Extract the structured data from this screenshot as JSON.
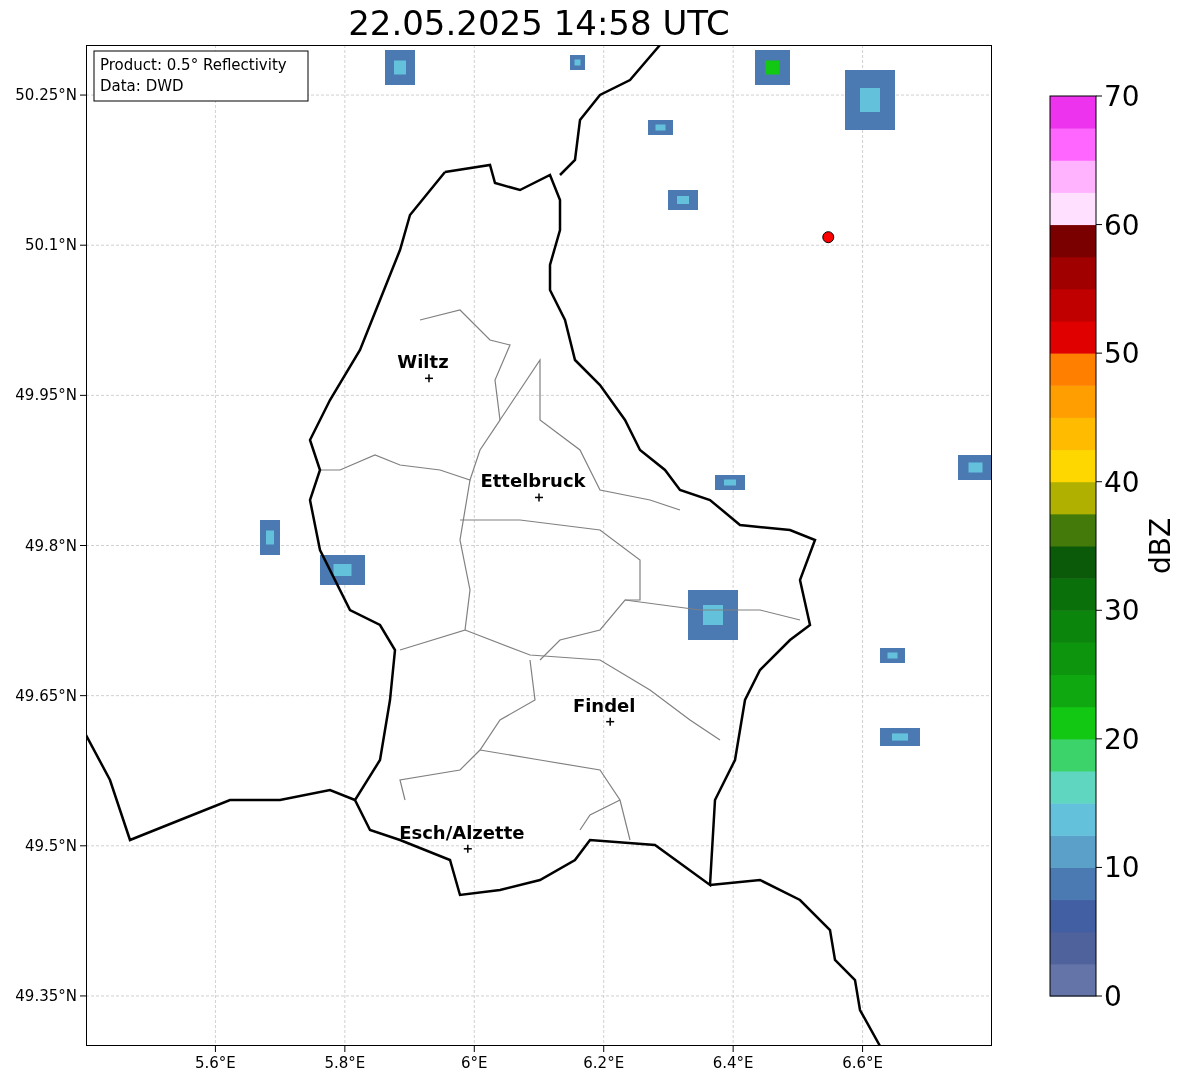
{
  "map": {
    "chart_data": {
      "type": "scatter",
      "title": "22.05.2025 14:58 UTC",
      "grid": true,
      "xlim": [
        5.4,
        6.8
      ],
      "ylim": [
        49.3,
        50.3
      ],
      "xticks": [
        {
          "value": 5.6,
          "label": "5.6°E"
        },
        {
          "value": 5.8,
          "label": "5.8°E"
        },
        {
          "value": 6.0,
          "label": "6°E"
        },
        {
          "value": 6.2,
          "label": "6.2°E"
        },
        {
          "value": 6.4,
          "label": "6.4°E"
        },
        {
          "value": 6.6,
          "label": "6.6°E"
        }
      ],
      "yticks": [
        {
          "value": 49.35,
          "label": "49.35°N"
        },
        {
          "value": 49.5,
          "label": "49.5°N"
        },
        {
          "value": 49.65,
          "label": "49.65°N"
        },
        {
          "value": 49.8,
          "label": "49.8°N"
        },
        {
          "value": 49.95,
          "label": "49.95°N"
        },
        {
          "value": 50.1,
          "label": "50.1°N"
        },
        {
          "value": 50.25,
          "label": "50.25°N"
        }
      ],
      "series": [
        {
          "color": "#000000",
          "x": [
            5.93,
            6.1,
            6.21,
            5.99
          ],
          "values": [
            49.967,
            49.848,
            49.624,
            49.497
          ]
        },
        {
          "color": "#ff0000",
          "x": [
            6.547
          ],
          "values": [
            50.108
          ]
        }
      ],
      "annotations": [
        {
          "text": "Wiltz",
          "x": 5.93,
          "y": 49.967
        },
        {
          "text": "Ettelbruck",
          "x": 6.1,
          "y": 49.848
        },
        {
          "text": "Findel",
          "x": 6.21,
          "y": 49.624
        },
        {
          "text": "Esch/Alzette",
          "x": 5.99,
          "y": 49.497
        }
      ]
    },
    "legend": [
      "Product: 0.5° Reflectivity",
      "Data: DWD"
    ]
  },
  "colorbar": {
    "label": "dBZ",
    "ticks": [
      "70",
      "60",
      "50",
      "40",
      "30",
      "20",
      "10",
      "0"
    ],
    "segments": [
      {
        "color": "#6574a8"
      },
      {
        "color": "#50629c"
      },
      {
        "color": "#435fa3"
      },
      {
        "color": "#4b7ab2"
      },
      {
        "color": "#5aa0c8"
      },
      {
        "color": "#63c1dc"
      },
      {
        "color": "#5fd6c0"
      },
      {
        "color": "#3cd46a"
      },
      {
        "color": "#12c812"
      },
      {
        "color": "#10a810"
      },
      {
        "color": "#0e950e"
      },
      {
        "color": "#0b850b"
      },
      {
        "color": "#0a700a"
      },
      {
        "color": "#0a5a0a"
      },
      {
        "color": "#447a0a"
      },
      {
        "color": "#b0b000"
      },
      {
        "color": "#ffd700"
      },
      {
        "color": "#ffbb00"
      },
      {
        "color": "#ff9e00"
      },
      {
        "color": "#ff8000"
      },
      {
        "color": "#e00000"
      },
      {
        "color": "#c00000"
      },
      {
        "color": "#a00000"
      },
      {
        "color": "#7a0000"
      },
      {
        "color": "#ffe0ff"
      },
      {
        "color": "#ffb3ff"
      },
      {
        "color": "#ff66ff"
      },
      {
        "color": "#ee33ee"
      }
    ]
  }
}
